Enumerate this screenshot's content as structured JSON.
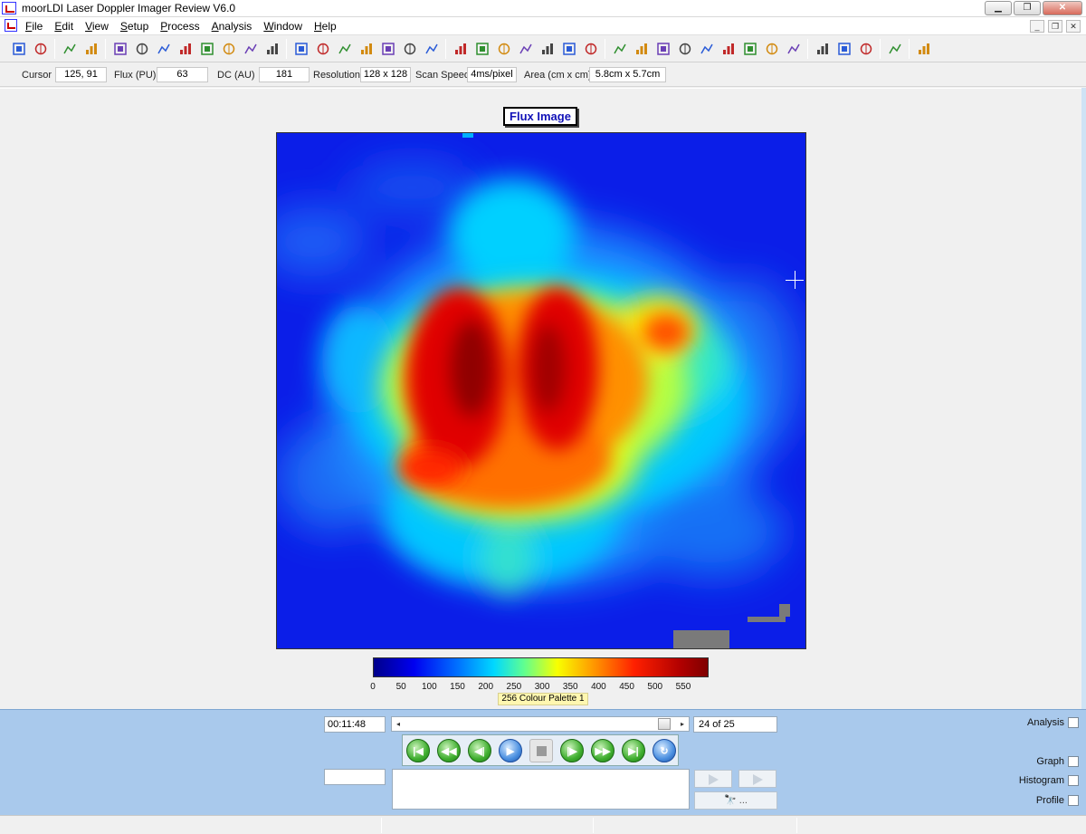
{
  "window": {
    "title": "moorLDI Laser Doppler Imager Review V6.0",
    "controls": [
      "▁",
      "❐",
      "✕"
    ],
    "doc_controls": [
      "_",
      "❐",
      "✕"
    ]
  },
  "menu": [
    {
      "label": "File",
      "accel": "F",
      "rest": "ile"
    },
    {
      "label": "Edit",
      "accel": "E",
      "rest": "dit"
    },
    {
      "label": "View",
      "accel": "V",
      "rest": "iew"
    },
    {
      "label": "Setup",
      "accel": "S",
      "rest": "etup"
    },
    {
      "label": "Process",
      "accel": "P",
      "rest": "rocess"
    },
    {
      "label": "Analysis",
      "accel": "A",
      "rest": "nalysis"
    },
    {
      "label": "Window",
      "accel": "W",
      "rest": "indow"
    },
    {
      "label": "Help",
      "accel": "H",
      "rest": "elp"
    }
  ],
  "toolbar_icons": [
    "open-file-icon",
    "save-file-icon",
    "report-icon",
    "print-preview-icon",
    "colour-palette-icon",
    "image-stack-icon",
    "spectrum-icon",
    "compare-icon",
    "mosaic-icon",
    "camera-icon",
    "grid-icon",
    "hand-pan-icon",
    "zoom-in-icon",
    "zoom-out-icon",
    "zoom-fit-icon",
    "trace-icon",
    "trace-2-icon",
    "up-arrow-icon",
    "down-arrow-icon",
    "point-icon",
    "region-tree-icon",
    "angle-icon",
    "rectangle-icon",
    "circle-icon",
    "polygon-icon",
    "line-icon",
    "mask-icon",
    "join-icon",
    "image-icon",
    "flag-icon",
    "flag-off-icon",
    "dots-icon",
    "blocks-icon",
    "blocks-2-icon",
    "blocks-3-icon",
    "spreadsheet-icon",
    "bar-chart-icon",
    "area-chart-icon",
    "printer-icon",
    "book-icon"
  ],
  "info": {
    "cursor_label": "Cursor",
    "cursor_value": "125, 91",
    "flux_label": "Flux (PU)",
    "flux_value": "63",
    "dc_label": "DC (AU)",
    "dc_value": "181",
    "resolution_label": "Resolution",
    "resolution_value": "128 x 128",
    "scan_speed_label": "Scan Speed",
    "scan_speed_value": "4ms/pixel",
    "area_label": "Area (cm x cm)",
    "area_value": "5.8cm x 5.7cm"
  },
  "image": {
    "title": "Flux Image",
    "scale_ticks": [
      "0",
      "50",
      "100",
      "150",
      "200",
      "250",
      "300",
      "350",
      "400",
      "450",
      "500",
      "550"
    ],
    "scale_max": 595,
    "palette_name": "256 Colour Palette 1"
  },
  "playback": {
    "time": "00:11:48",
    "frame_label": "24 of 25",
    "frame_fraction": 0.958,
    "scroll_left": "◂",
    "scroll_right": "▸",
    "find_label": "🔭 ..."
  },
  "side_panel": {
    "analysis": "Analysis",
    "graph": "Graph",
    "histogram": "Histogram",
    "profile": "Profile"
  }
}
